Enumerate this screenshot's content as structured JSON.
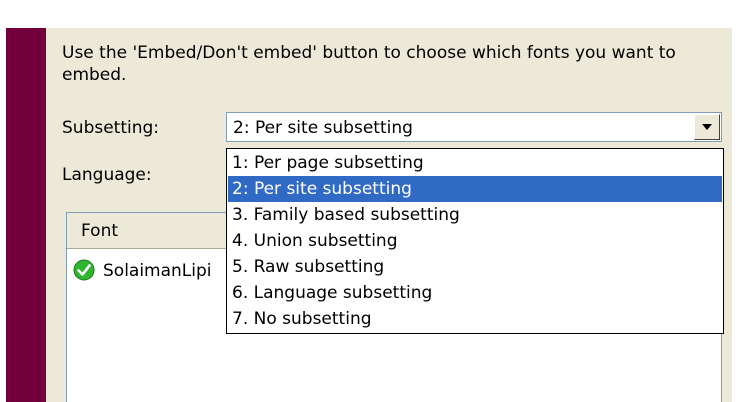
{
  "dialog": {
    "instruction": "Use the 'Embed/Don't embed' button to choose which fonts you want to embed."
  },
  "subsetting": {
    "label": "Subsetting:",
    "selected": "2: Per site subsetting",
    "options": [
      "1: Per page subsetting",
      "2: Per site subsetting",
      "3. Family based subsetting",
      "4. Union subsetting",
      "5. Raw subsetting",
      "6. Language subsetting",
      "7. No subsetting"
    ],
    "highlighted_index": 1
  },
  "language": {
    "label": "Language:"
  },
  "font_list": {
    "column_header": "Font",
    "rows": [
      {
        "name": "SolaimanLipi",
        "status_icon": "green-check-icon"
      }
    ]
  },
  "colors": {
    "accent_strip": "#73003d",
    "selection": "#316ac5",
    "panel": "#ece9d8"
  }
}
